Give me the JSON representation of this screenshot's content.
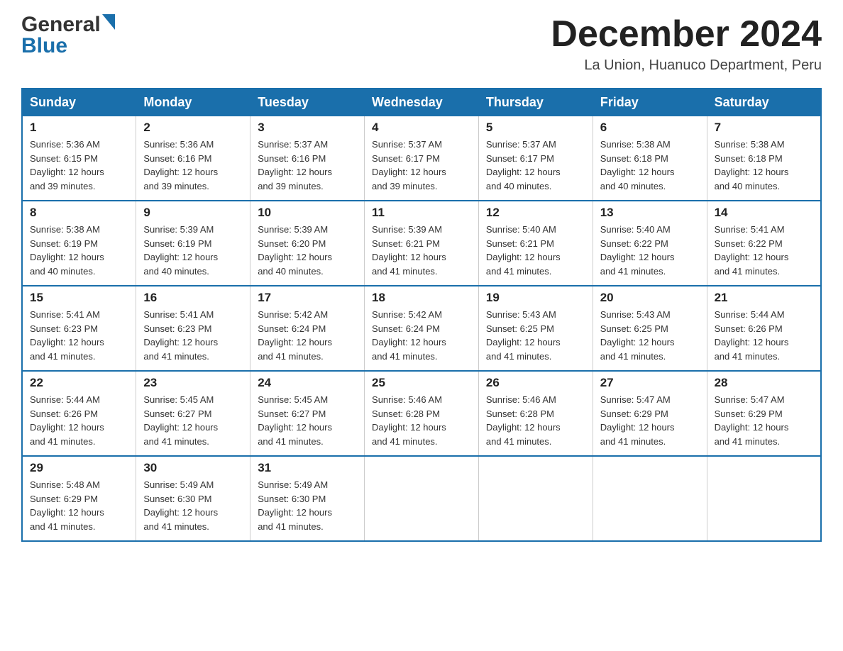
{
  "header": {
    "logo_general": "General",
    "logo_blue": "Blue",
    "title": "December 2024",
    "subtitle": "La Union, Huanuco Department, Peru"
  },
  "days_of_week": [
    "Sunday",
    "Monday",
    "Tuesday",
    "Wednesday",
    "Thursday",
    "Friday",
    "Saturday"
  ],
  "weeks": [
    [
      {
        "day": "1",
        "sunrise": "5:36 AM",
        "sunset": "6:15 PM",
        "daylight": "12 hours and 39 minutes."
      },
      {
        "day": "2",
        "sunrise": "5:36 AM",
        "sunset": "6:16 PM",
        "daylight": "12 hours and 39 minutes."
      },
      {
        "day": "3",
        "sunrise": "5:37 AM",
        "sunset": "6:16 PM",
        "daylight": "12 hours and 39 minutes."
      },
      {
        "day": "4",
        "sunrise": "5:37 AM",
        "sunset": "6:17 PM",
        "daylight": "12 hours and 39 minutes."
      },
      {
        "day": "5",
        "sunrise": "5:37 AM",
        "sunset": "6:17 PM",
        "daylight": "12 hours and 40 minutes."
      },
      {
        "day": "6",
        "sunrise": "5:38 AM",
        "sunset": "6:18 PM",
        "daylight": "12 hours and 40 minutes."
      },
      {
        "day": "7",
        "sunrise": "5:38 AM",
        "sunset": "6:18 PM",
        "daylight": "12 hours and 40 minutes."
      }
    ],
    [
      {
        "day": "8",
        "sunrise": "5:38 AM",
        "sunset": "6:19 PM",
        "daylight": "12 hours and 40 minutes."
      },
      {
        "day": "9",
        "sunrise": "5:39 AM",
        "sunset": "6:19 PM",
        "daylight": "12 hours and 40 minutes."
      },
      {
        "day": "10",
        "sunrise": "5:39 AM",
        "sunset": "6:20 PM",
        "daylight": "12 hours and 40 minutes."
      },
      {
        "day": "11",
        "sunrise": "5:39 AM",
        "sunset": "6:21 PM",
        "daylight": "12 hours and 41 minutes."
      },
      {
        "day": "12",
        "sunrise": "5:40 AM",
        "sunset": "6:21 PM",
        "daylight": "12 hours and 41 minutes."
      },
      {
        "day": "13",
        "sunrise": "5:40 AM",
        "sunset": "6:22 PM",
        "daylight": "12 hours and 41 minutes."
      },
      {
        "day": "14",
        "sunrise": "5:41 AM",
        "sunset": "6:22 PM",
        "daylight": "12 hours and 41 minutes."
      }
    ],
    [
      {
        "day": "15",
        "sunrise": "5:41 AM",
        "sunset": "6:23 PM",
        "daylight": "12 hours and 41 minutes."
      },
      {
        "day": "16",
        "sunrise": "5:41 AM",
        "sunset": "6:23 PM",
        "daylight": "12 hours and 41 minutes."
      },
      {
        "day": "17",
        "sunrise": "5:42 AM",
        "sunset": "6:24 PM",
        "daylight": "12 hours and 41 minutes."
      },
      {
        "day": "18",
        "sunrise": "5:42 AM",
        "sunset": "6:24 PM",
        "daylight": "12 hours and 41 minutes."
      },
      {
        "day": "19",
        "sunrise": "5:43 AM",
        "sunset": "6:25 PM",
        "daylight": "12 hours and 41 minutes."
      },
      {
        "day": "20",
        "sunrise": "5:43 AM",
        "sunset": "6:25 PM",
        "daylight": "12 hours and 41 minutes."
      },
      {
        "day": "21",
        "sunrise": "5:44 AM",
        "sunset": "6:26 PM",
        "daylight": "12 hours and 41 minutes."
      }
    ],
    [
      {
        "day": "22",
        "sunrise": "5:44 AM",
        "sunset": "6:26 PM",
        "daylight": "12 hours and 41 minutes."
      },
      {
        "day": "23",
        "sunrise": "5:45 AM",
        "sunset": "6:27 PM",
        "daylight": "12 hours and 41 minutes."
      },
      {
        "day": "24",
        "sunrise": "5:45 AM",
        "sunset": "6:27 PM",
        "daylight": "12 hours and 41 minutes."
      },
      {
        "day": "25",
        "sunrise": "5:46 AM",
        "sunset": "6:28 PM",
        "daylight": "12 hours and 41 minutes."
      },
      {
        "day": "26",
        "sunrise": "5:46 AM",
        "sunset": "6:28 PM",
        "daylight": "12 hours and 41 minutes."
      },
      {
        "day": "27",
        "sunrise": "5:47 AM",
        "sunset": "6:29 PM",
        "daylight": "12 hours and 41 minutes."
      },
      {
        "day": "28",
        "sunrise": "5:47 AM",
        "sunset": "6:29 PM",
        "daylight": "12 hours and 41 minutes."
      }
    ],
    [
      {
        "day": "29",
        "sunrise": "5:48 AM",
        "sunset": "6:29 PM",
        "daylight": "12 hours and 41 minutes."
      },
      {
        "day": "30",
        "sunrise": "5:49 AM",
        "sunset": "6:30 PM",
        "daylight": "12 hours and 41 minutes."
      },
      {
        "day": "31",
        "sunrise": "5:49 AM",
        "sunset": "6:30 PM",
        "daylight": "12 hours and 41 minutes."
      },
      null,
      null,
      null,
      null
    ]
  ],
  "labels": {
    "sunrise": "Sunrise:",
    "sunset": "Sunset:",
    "daylight": "Daylight:"
  }
}
